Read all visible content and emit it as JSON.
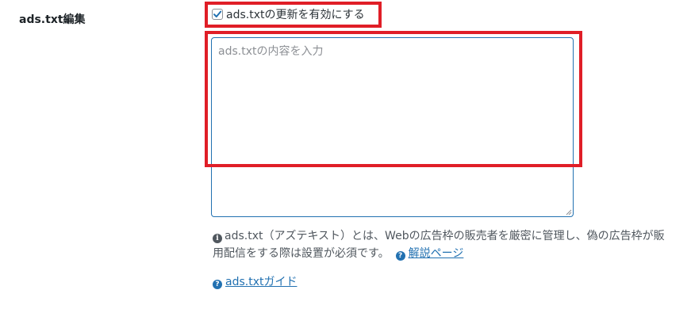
{
  "field": {
    "label": "ads.txt編集"
  },
  "enable_checkbox": {
    "label": "ads.txtの更新を有効にする",
    "checked": true
  },
  "textarea": {
    "value": "",
    "placeholder": "ads.txtの内容を入力"
  },
  "description": {
    "line1": "ads.txt（アズテキスト）とは、Webの広告枠の販売者を厳密に管理し、偽の広告枠が販",
    "line2": "用配信をする際は設置が必須です。",
    "help_link_label": "解説ページ"
  },
  "guide_link": {
    "label": "ads.txtガイド"
  },
  "colors": {
    "accent": "#2271b1",
    "highlight": "#e01e27",
    "text": "#1d2327",
    "muted": "#50575e"
  },
  "icons": {
    "checkbox_check": "check-icon",
    "info": "info-circle-icon",
    "help": "question-circle-icon",
    "resize": "resize-grip-icon"
  }
}
